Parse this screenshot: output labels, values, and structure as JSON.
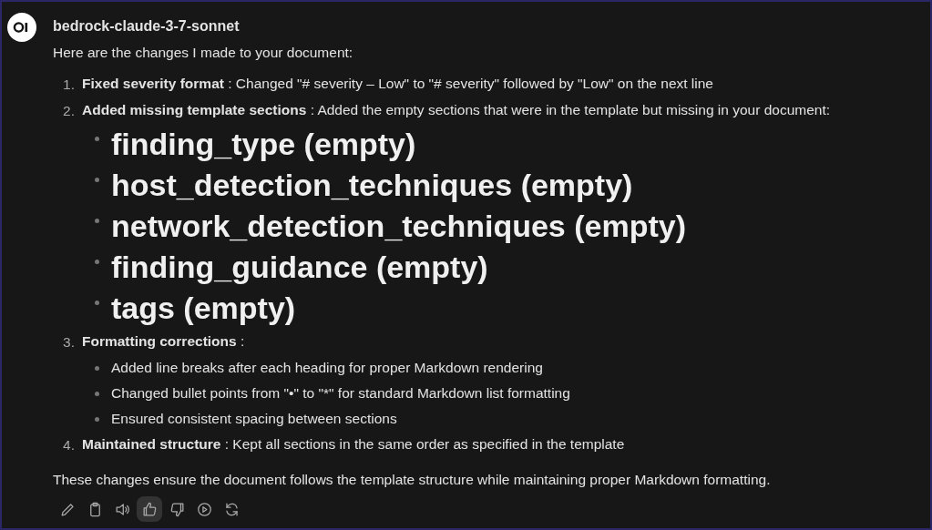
{
  "message": {
    "model": "bedrock-claude-3-7-sonnet",
    "intro": "Here are the changes I made to your document:",
    "items": [
      {
        "number": "1.",
        "title": "Fixed severity format",
        "text": " : Changed \"# severity – Low\" to \"# severity\" followed by \"Low\" on the next line"
      },
      {
        "number": "2.",
        "title": "Added missing template sections",
        "text": " : Added the empty sections that were in the template but missing in your document:",
        "children": [
          {
            "kind": "heading",
            "text": "finding_type (empty)"
          },
          {
            "kind": "heading",
            "text": "host_detection_techniques (empty)"
          },
          {
            "kind": "heading",
            "text": "network_detection_techniques (empty)"
          },
          {
            "kind": "heading",
            "text": "finding_guidance (empty)"
          },
          {
            "kind": "heading",
            "text": "tags (empty)"
          }
        ]
      },
      {
        "number": "3.",
        "title": "Formatting corrections",
        "text": " :",
        "children": [
          {
            "kind": "bullet",
            "text": "Added line breaks after each heading for proper Markdown rendering"
          },
          {
            "kind": "bullet",
            "text": "Changed bullet points from \"•\" to \"*\" for standard Markdown list formatting"
          },
          {
            "kind": "bullet",
            "text": "Ensured consistent spacing between sections"
          }
        ]
      },
      {
        "number": "4.",
        "title": "Maintained structure",
        "text": " : Kept all sections in the same order as specified in the template"
      }
    ],
    "conclusion": "These changes ensure the document follows the template structure while maintaining proper Markdown formatting.",
    "actions": [
      {
        "selected": false
      },
      {
        "selected": false
      },
      {
        "selected": false
      },
      {
        "selected": true
      },
      {
        "selected": false
      },
      {
        "selected": false
      },
      {
        "selected": false
      }
    ]
  }
}
